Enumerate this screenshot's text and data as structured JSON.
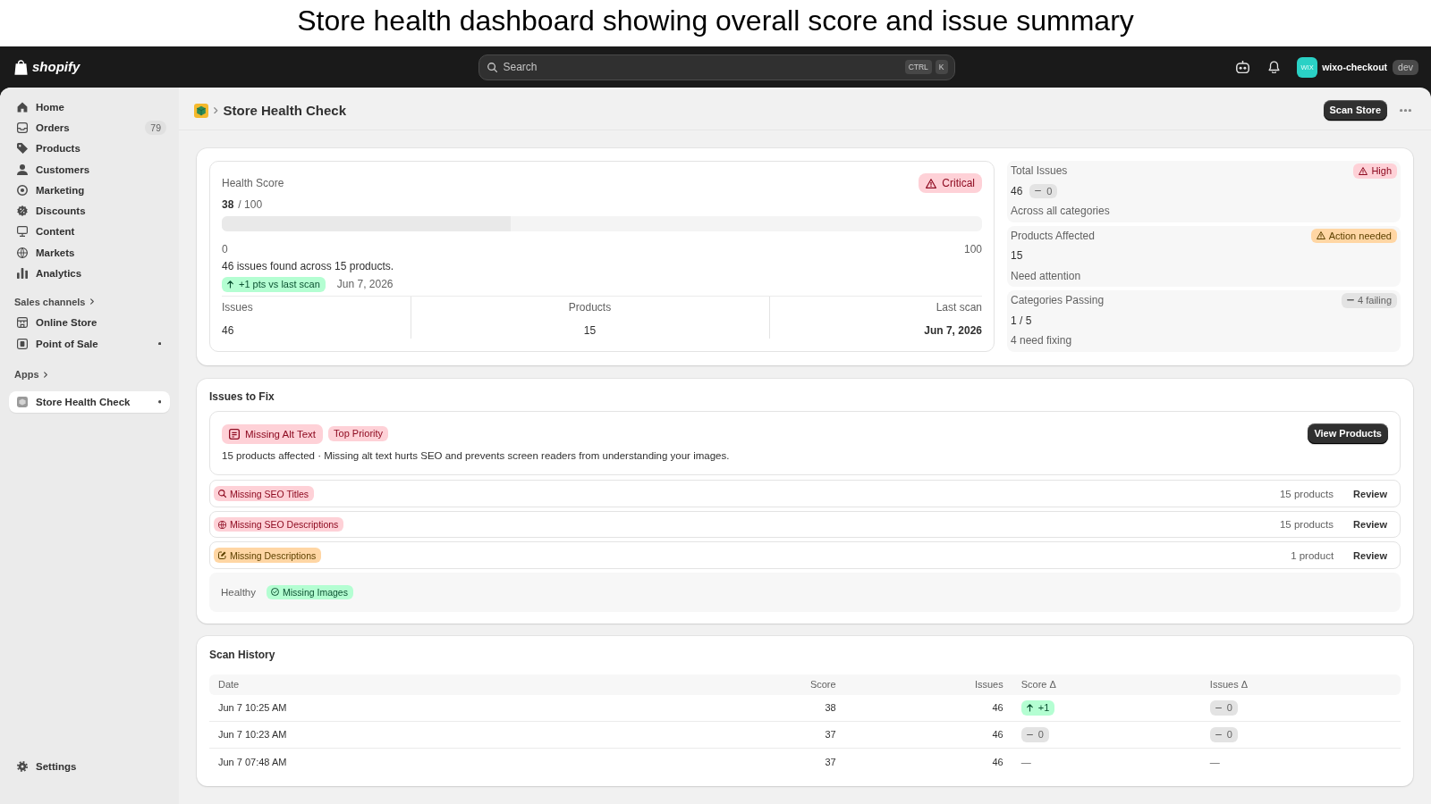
{
  "caption": "Store health dashboard showing overall score and issue summary",
  "top_bar": {
    "logo": "shopify",
    "search": {
      "placeholder": "Search",
      "shortcut": [
        "CTRL",
        "K"
      ]
    },
    "store": {
      "avatar": "WIX",
      "name": "wixo-checkout",
      "badge": "dev"
    }
  },
  "sidebar": {
    "items": [
      {
        "label": "Home",
        "selected": false
      },
      {
        "label": "Orders",
        "count": "79",
        "selected": false
      },
      {
        "label": "Products",
        "selected": false
      },
      {
        "label": "Customers",
        "selected": false
      },
      {
        "label": "Marketing",
        "selected": false
      },
      {
        "label": "Discounts",
        "selected": false
      },
      {
        "label": "Content",
        "selected": false
      },
      {
        "label": "Markets",
        "selected": false
      },
      {
        "label": "Analytics",
        "selected": false
      }
    ],
    "sections": [
      {
        "title": "Sales channels",
        "items": [
          {
            "label": "Online Store",
            "selected": false,
            "dot": false
          },
          {
            "label": "Point of Sale",
            "selected": false,
            "dot": true
          }
        ]
      },
      {
        "title": "Apps",
        "items": [
          {
            "label": "Store Health Check",
            "selected": true,
            "dot": true
          }
        ]
      }
    ],
    "footer": {
      "label": "Settings",
      "selected": false
    }
  },
  "page_header": {
    "title": "Store Health Check",
    "primary_action": "Scan Store"
  },
  "overview": {
    "health": {
      "label": "Health Score",
      "status": {
        "label": "Critical",
        "kind": "critical"
      },
      "score": "38",
      "out_of": "/ 100",
      "progress": {
        "level": 0.38,
        "min_label": "0",
        "max_label": "100"
      },
      "summary": "46 issues found across 15 products.",
      "trend": {
        "label": "+1 pts vs last scan",
        "kind": "up"
      },
      "date": "Jun 7, 2026",
      "stats": [
        {
          "label": "Issues",
          "value": "46"
        },
        {
          "label": "Products",
          "value": "15"
        },
        {
          "label": "Last scan",
          "value": "Jun 7, 2026"
        }
      ]
    },
    "metrics": [
      {
        "label": "Total Issues",
        "badge": {
          "label": "High",
          "kind": "critical"
        },
        "value": "46",
        "delta": {
          "label": "0",
          "kind": "flat"
        },
        "note": "Across all categories"
      },
      {
        "label": "Products Affected",
        "badge": {
          "label": "Action needed",
          "kind": "warning"
        },
        "value": "15",
        "note": "Need attention"
      },
      {
        "label": "Categories Passing",
        "badge": {
          "label": "4 failing",
          "kind": "neutral"
        },
        "value": "1 / 5",
        "note": "4 need fixing"
      }
    ]
  },
  "issues": {
    "title": "Issues to Fix",
    "top_issue": {
      "tag": "Missing Alt Text",
      "kind": "critical",
      "priority": "Top Priority",
      "description": "15 products affected · Missing alt text hurts SEO and prevents screen readers from understanding your images.",
      "action": "View Products"
    },
    "rows": [
      {
        "tag": "Missing SEO Titles",
        "kind": "critical",
        "count": "15 products",
        "action": "Review"
      },
      {
        "tag": "Missing SEO Descriptions",
        "kind": "critical",
        "count": "15 products",
        "action": "Review"
      },
      {
        "tag": "Missing Descriptions",
        "kind": "warning",
        "count": "1 product",
        "action": "Review"
      }
    ],
    "healthy": {
      "label": "Healthy",
      "tags": [
        {
          "tag": "Missing Images",
          "kind": "success"
        }
      ]
    }
  },
  "scan_history": {
    "title": "Scan History",
    "columns": [
      "Date",
      "Score",
      "Issues",
      "Score Δ",
      "Issues Δ"
    ],
    "rows": [
      {
        "date": "Jun 7 10:25 AM",
        "score": "38",
        "issues": "46",
        "score_delta": {
          "label": "+1",
          "kind": "up"
        },
        "issues_delta": {
          "label": "0",
          "kind": "flat"
        }
      },
      {
        "date": "Jun 7 10:23 AM",
        "score": "37",
        "issues": "46",
        "score_delta": {
          "label": "0",
          "kind": "flat"
        },
        "issues_delta": {
          "label": "0",
          "kind": "flat"
        }
      },
      {
        "date": "Jun 7 07:48 AM",
        "score": "37",
        "issues": "46",
        "score_delta": {
          "label": "—",
          "kind": "none"
        },
        "issues_delta": {
          "label": "—",
          "kind": "none"
        }
      }
    ]
  }
}
